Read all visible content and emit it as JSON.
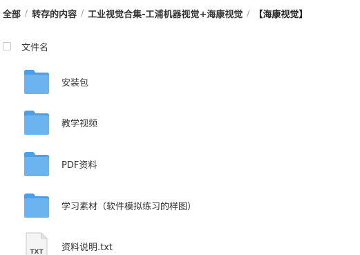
{
  "breadcrumb": [
    {
      "label": "全部"
    },
    {
      "label": "转存的内容"
    },
    {
      "label": "工业视觉合集-工浦机器视觉+海康视觉"
    },
    {
      "label": "【海康视觉】"
    }
  ],
  "breadcrumb_separator": "/",
  "list_header": {
    "name_column": "文件名"
  },
  "files": [
    {
      "name": "安装包",
      "type": "folder",
      "icon": "folder-icon"
    },
    {
      "name": "教学视频",
      "type": "folder",
      "icon": "folder-icon"
    },
    {
      "name": "PDF资料",
      "type": "folder",
      "icon": "folder-icon"
    },
    {
      "name": "学习素材（软件模拟练习的样图）",
      "type": "folder",
      "icon": "folder-icon"
    },
    {
      "name": "资料说明.txt",
      "type": "txt",
      "icon": "txt-file-icon",
      "icon_text": "TXT"
    }
  ],
  "colors": {
    "folder_body": "#6cb4f0",
    "folder_tab": "#4a9fe8",
    "text": "#333333",
    "separator": "#999999"
  }
}
